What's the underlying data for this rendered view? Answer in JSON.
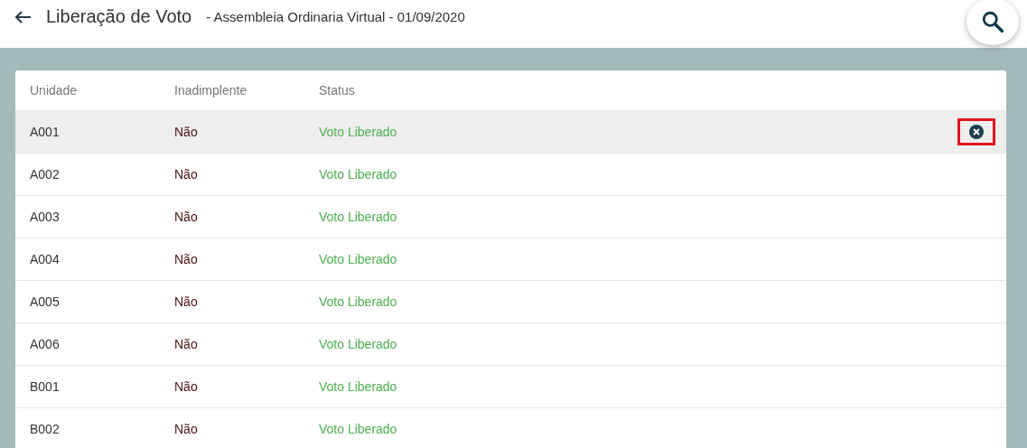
{
  "header": {
    "title": "Liberação de Voto",
    "subtitle": "- Assembleia Ordinaria Virtual - 01/09/2020"
  },
  "table": {
    "columns": [
      "Unidade",
      "Inadimplente",
      "Status"
    ],
    "rows": [
      {
        "unit": "A001",
        "delinquent": "Não",
        "status": "Voto Liberado",
        "selected": true
      },
      {
        "unit": "A002",
        "delinquent": "Não",
        "status": "Voto Liberado",
        "selected": false
      },
      {
        "unit": "A003",
        "delinquent": "Não",
        "status": "Voto Liberado",
        "selected": false
      },
      {
        "unit": "A004",
        "delinquent": "Não",
        "status": "Voto Liberado",
        "selected": false
      },
      {
        "unit": "A005",
        "delinquent": "Não",
        "status": "Voto Liberado",
        "selected": false
      },
      {
        "unit": "A006",
        "delinquent": "Não",
        "status": "Voto Liberado",
        "selected": false
      },
      {
        "unit": "B001",
        "delinquent": "Não",
        "status": "Voto Liberado",
        "selected": false
      },
      {
        "unit": "B002",
        "delinquent": "Não",
        "status": "Voto Liberado",
        "selected": false
      }
    ]
  }
}
